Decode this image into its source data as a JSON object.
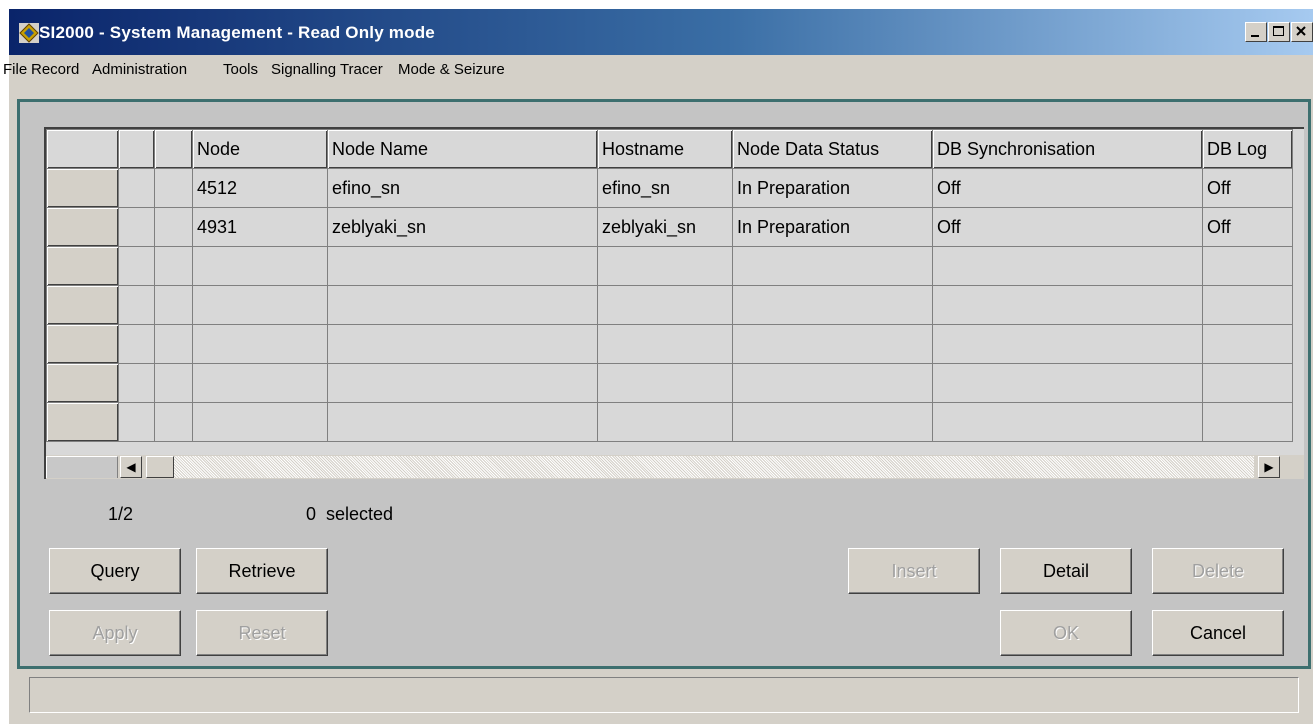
{
  "window": {
    "title": "SI2000 - System Management - Read Only mode",
    "controls": [
      "_",
      "□",
      "×"
    ]
  },
  "menu": [
    "File",
    "Record",
    "Administration",
    "Tools",
    "Signalling Tracer",
    "Mode & Seizure"
  ],
  "table": {
    "columns": [
      "Node",
      "Node Name",
      "Hostname",
      "Node Data Status",
      "DB Synchronisation",
      "DB Log"
    ],
    "rows": [
      [
        "4512",
        "efino_sn",
        "efino_sn",
        "In Preparation",
        "Off",
        "Off"
      ],
      [
        "4931",
        "zeblyaki_sn",
        "zeblyaki_sn",
        "In Preparation",
        "Off",
        "Off"
      ],
      [
        "",
        "",
        "",
        "",
        "",
        ""
      ],
      [
        "",
        "",
        "",
        "",
        "",
        ""
      ],
      [
        "",
        "",
        "",
        "",
        "",
        ""
      ],
      [
        "",
        "",
        "",
        "",
        "",
        ""
      ],
      [
        "",
        "",
        "",
        "",
        "",
        ""
      ]
    ]
  },
  "status": {
    "page": "1/2",
    "selected": "0  selected"
  },
  "buttons": {
    "query": "Query",
    "retrieve": "Retrieve",
    "apply": "Apply",
    "reset": "Reset",
    "insert": "Insert",
    "detail": "Detail",
    "delete": "Delete",
    "ok": "OK",
    "cancel": "Cancel"
  },
  "colors": {
    "titlebar_start": "#0a246a",
    "titlebar_end": "#a6caf0",
    "frame_border": "#3d6f6f",
    "face": "#d4d0c8"
  }
}
